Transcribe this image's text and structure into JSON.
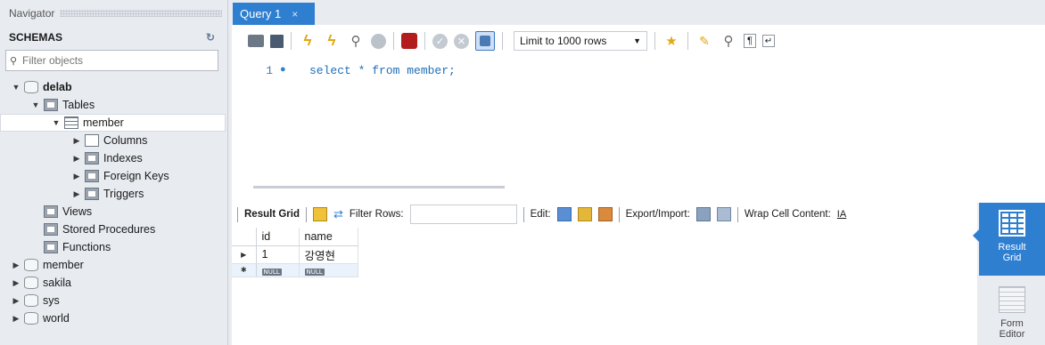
{
  "navigator": {
    "title": "Navigator",
    "schemas_label": "SCHEMAS",
    "filter_placeholder": "Filter objects",
    "tree": {
      "delab": "delab",
      "tables": "Tables",
      "member_table": "member",
      "columns": "Columns",
      "indexes": "Indexes",
      "foreign_keys": "Foreign Keys",
      "triggers": "Triggers",
      "views": "Views",
      "stored_procedures": "Stored Procedures",
      "functions": "Functions",
      "other_schemas": [
        "member",
        "sakila",
        "sys",
        "world"
      ]
    }
  },
  "query_tab": {
    "label": "Query 1",
    "close": "×"
  },
  "toolbar": {
    "limit_label": "Limit to 1000 rows"
  },
  "editor": {
    "line_number": "1",
    "line_marker": "●",
    "code": "select * from member;"
  },
  "result_bar": {
    "result_grid": "Result Grid",
    "filter_rows": "Filter Rows:",
    "edit": "Edit:",
    "export_import": "Export/Import:",
    "wrap_cell": "Wrap Cell Content:",
    "wrap_glyph": "IA"
  },
  "grid": {
    "columns": [
      "id",
      "name"
    ],
    "rows": [
      {
        "marker": "▶",
        "id": "1",
        "name": "강영현"
      }
    ],
    "new_row_marker": "✱",
    "null_label": "NULL"
  },
  "side_panel": {
    "result_grid": "Result\nGrid",
    "result_grid_l1": "Result",
    "result_grid_l2": "Grid",
    "form_editor_l1": "Form",
    "form_editor_l2": "Editor"
  },
  "colors": {
    "accent": "#2f7fd1",
    "code": "#1f6fb8",
    "background": "#e8ebf0"
  }
}
